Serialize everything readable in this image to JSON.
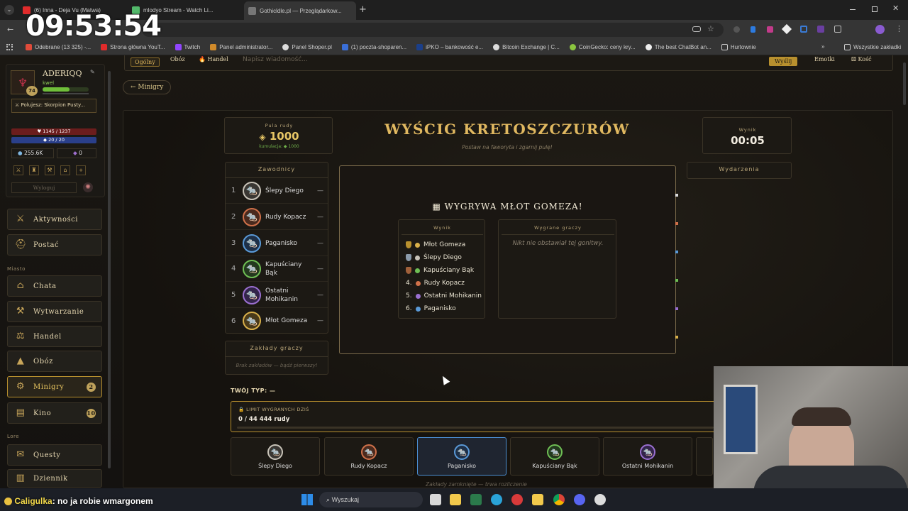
{
  "browser": {
    "tabs": [
      {
        "title": "(6) Inna - Deja Vu (Matwa)"
      },
      {
        "title": "mlodyo Stream - Watch Li..."
      },
      {
        "title": "Gothicldle.pl — Przeglądarkow..."
      }
    ],
    "new_tab": "+",
    "bookmarks": [
      "Odebrane (13 325) -...",
      "Strona główna YouT...",
      "Twitch",
      "Panel administrator...",
      "Panel Shoper.pl",
      "(1) poczta-shoparen...",
      "iPKO – bankowość e...",
      "Bitcoin Exchange | C...",
      "CoinGecko: ceny kry...",
      "The best ChatBot an...",
      "Hurtownie"
    ],
    "all_bookmarks": "Wszystkie zakładki"
  },
  "overlay_clock": "09:53:54",
  "chat_bar": {
    "tabs": [
      "Ogólny",
      "Obóz",
      "Handel"
    ],
    "placeholder": "Napisz wiadomość...",
    "send": "Wyślij",
    "emotes": "Emotki",
    "dice": "Kość"
  },
  "profile": {
    "name": "ADERIQQ",
    "subtitle": "kwel",
    "level": "74",
    "quest": "Polujesz: Skorpion Pusty...",
    "hp": "1145 / 1237",
    "mana": "20 / 20",
    "gold": "255.6K",
    "gems": "0",
    "logout": "Wyloguj"
  },
  "nav": {
    "aktywnosci": "Aktywności",
    "postac": "Postać",
    "section_miasto": "Miasto",
    "chata": "Chata",
    "wytwarzanie": "Wytwarzanie",
    "handel": "Handel",
    "oboz": "Obóz",
    "minigry": "Minigry",
    "minigry_badge": "2",
    "kino": "Kino",
    "kino_badge": "10",
    "section_lore": "Lore",
    "questy": "Questy",
    "dziennik": "Dziennik"
  },
  "back_button": "← Minigry",
  "pool": {
    "label": "Pula rudy",
    "value": "1000",
    "note": "kumulacja: ◆ 1000"
  },
  "title": "Wyścig Kretoszczurów",
  "subtitle": "Postaw na faworyta i zgarnij pulę!",
  "timer": {
    "label": "Wynik",
    "value": "00:05"
  },
  "racers_header": "Zawodnicy",
  "racers": [
    {
      "num": "1",
      "name": "Ślepy Diego",
      "odds": "—",
      "color": "#c8c3b8"
    },
    {
      "num": "2",
      "name": "Rudy Kopacz",
      "odds": "—",
      "color": "#d0714a"
    },
    {
      "num": "3",
      "name": "Paganisko",
      "odds": "—",
      "color": "#5a9ad8"
    },
    {
      "num": "4",
      "name": "Kapuściany Bąk",
      "odds": "—",
      "color": "#6fbf55"
    },
    {
      "num": "5",
      "name": "Ostatni Mohikanin",
      "odds": "—",
      "color": "#9a6fd0"
    },
    {
      "num": "6",
      "name": "Młot Gomeza",
      "odds": "—",
      "color": "#d9b04a"
    }
  ],
  "bets_header": "Zakłady graczy",
  "bets_empty": "Brak zakładów — bądź pierwszy!",
  "events_header": "Wydarzenia",
  "winner_banner": "Wygrywa Młot Gomeza!",
  "result_header": "Wynik",
  "results": [
    {
      "pos": "1",
      "name": "Młot Gomeza",
      "color": "#d9b04a",
      "medal": true
    },
    {
      "pos": "2",
      "name": "Ślepy Diego",
      "color": "#c8c3b8",
      "medal": true
    },
    {
      "pos": "3",
      "name": "Kapuściany Bąk",
      "color": "#6fbf55",
      "medal": true
    },
    {
      "pos": "4.",
      "name": "Rudy Kopacz",
      "color": "#d0714a",
      "medal": false
    },
    {
      "pos": "5.",
      "name": "Ostatni Mohikanin",
      "color": "#9a6fd0",
      "medal": false
    },
    {
      "pos": "6.",
      "name": "Paganisko",
      "color": "#5a9ad8",
      "medal": false
    }
  ],
  "winners_header": "Wygrane graczy",
  "winners_empty": "Nikt nie obstawiał tej gonitwy.",
  "your_pick": "Twój typ: —",
  "limit": {
    "label": "Limit wygranych dziś",
    "value": "0 / 44 444 rudy"
  },
  "picks": [
    {
      "name": "Ślepy Diego",
      "color": "#c8c3b8",
      "selected": false
    },
    {
      "name": "Rudy Kopacz",
      "color": "#d0714a",
      "selected": false
    },
    {
      "name": "Paganisko",
      "color": "#5a9ad8",
      "selected": true
    },
    {
      "name": "Kapuściany Bąk",
      "color": "#6fbf55",
      "selected": false
    },
    {
      "name": "Ostatni Mohikanin",
      "color": "#9a6fd0",
      "selected": false
    }
  ],
  "closed_note": "Zakłady zamknięte — trwa rozliczenie",
  "stream_chat": {
    "user": "Caligulka",
    "message": ": no ja robie wmargonem"
  },
  "taskbar": {
    "search": "Wyszukaj"
  }
}
